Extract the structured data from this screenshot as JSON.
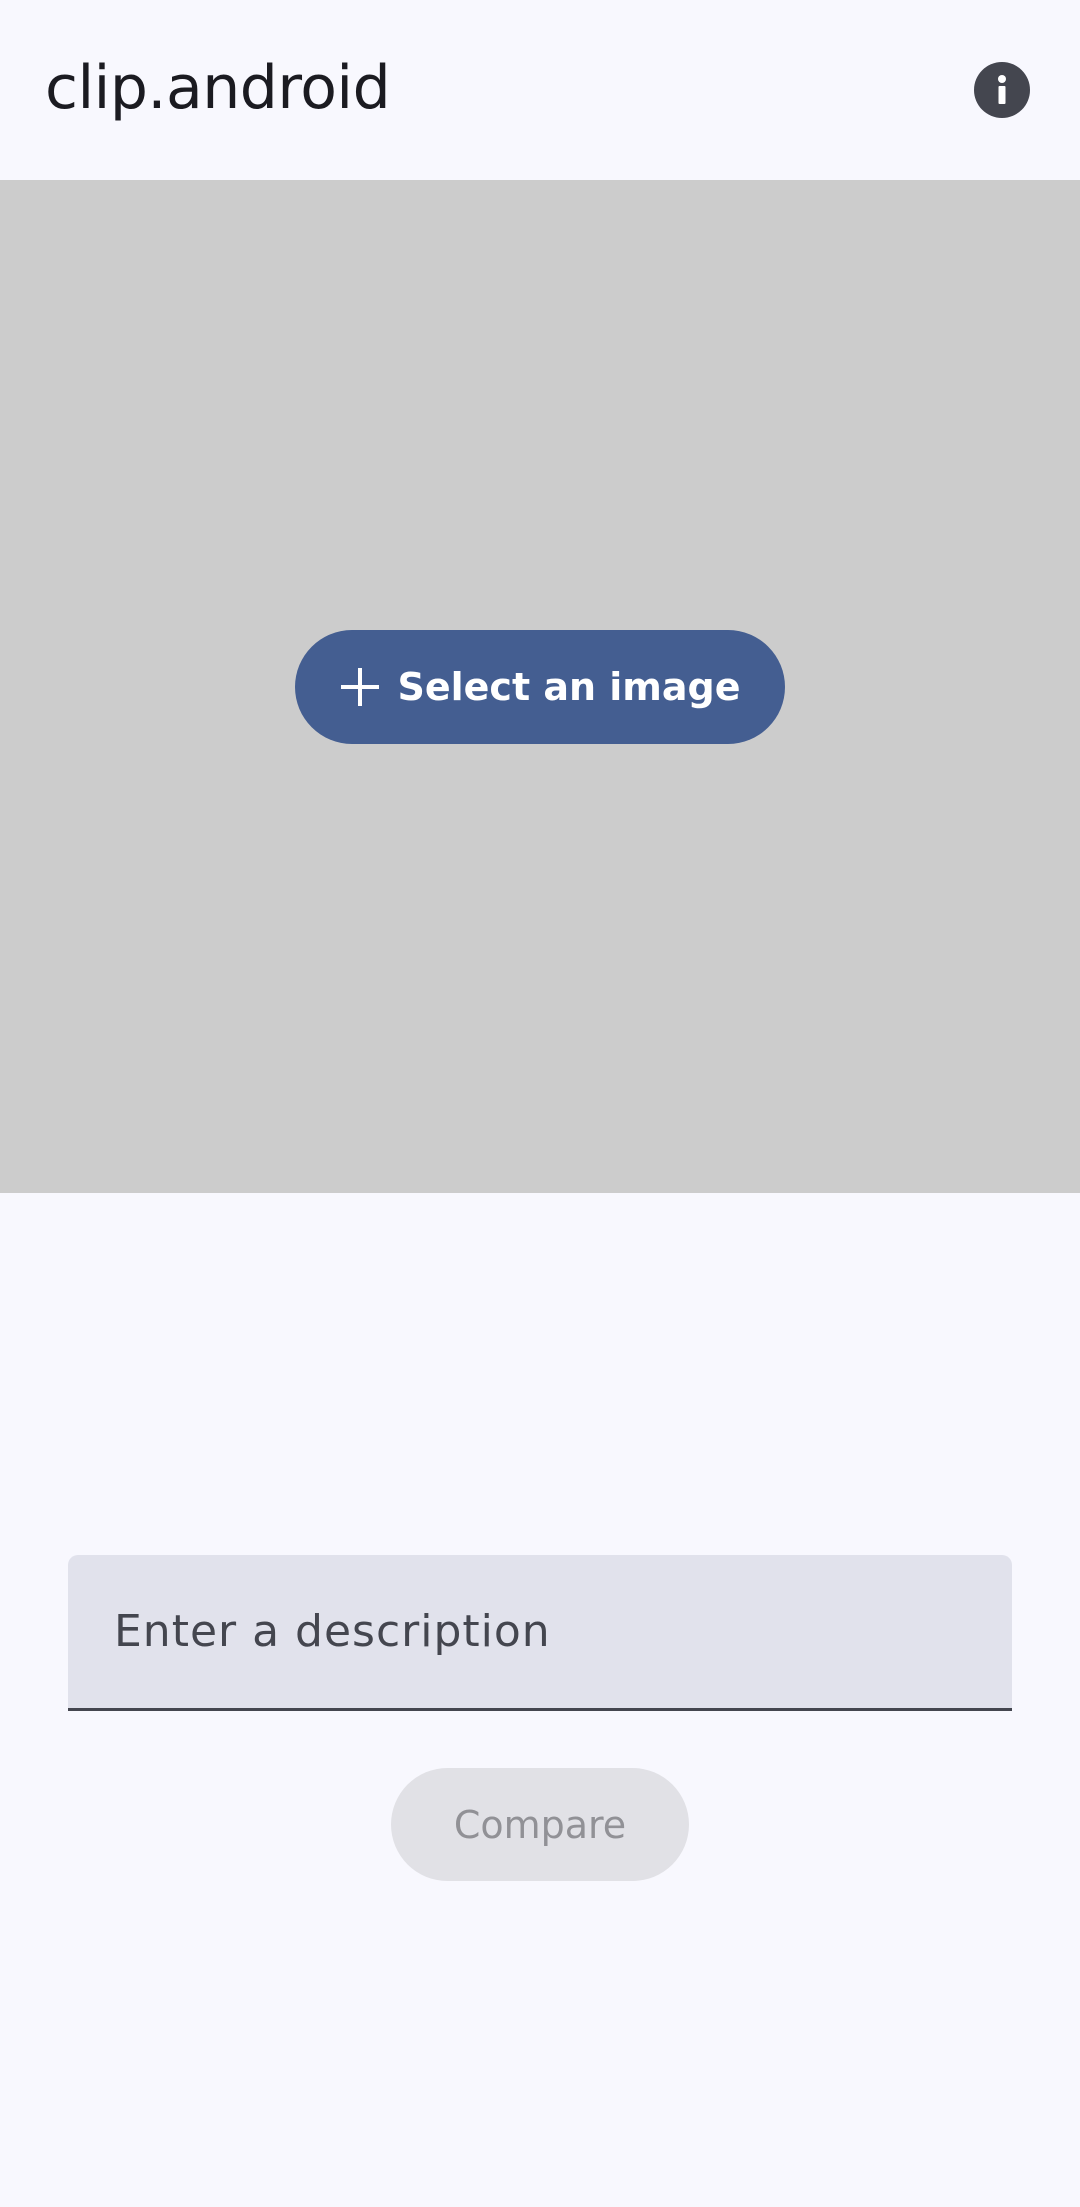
{
  "app_bar": {
    "title": "clip.android",
    "info_icon": "info-icon"
  },
  "image_area": {
    "select_button_label": "Select an image",
    "select_button_icon": "plus-icon",
    "background_color": "#cccccc",
    "button_color": "#445e91"
  },
  "description_field": {
    "placeholder": "Enter a description",
    "value": ""
  },
  "compare_button": {
    "label": "Compare",
    "enabled": false
  }
}
